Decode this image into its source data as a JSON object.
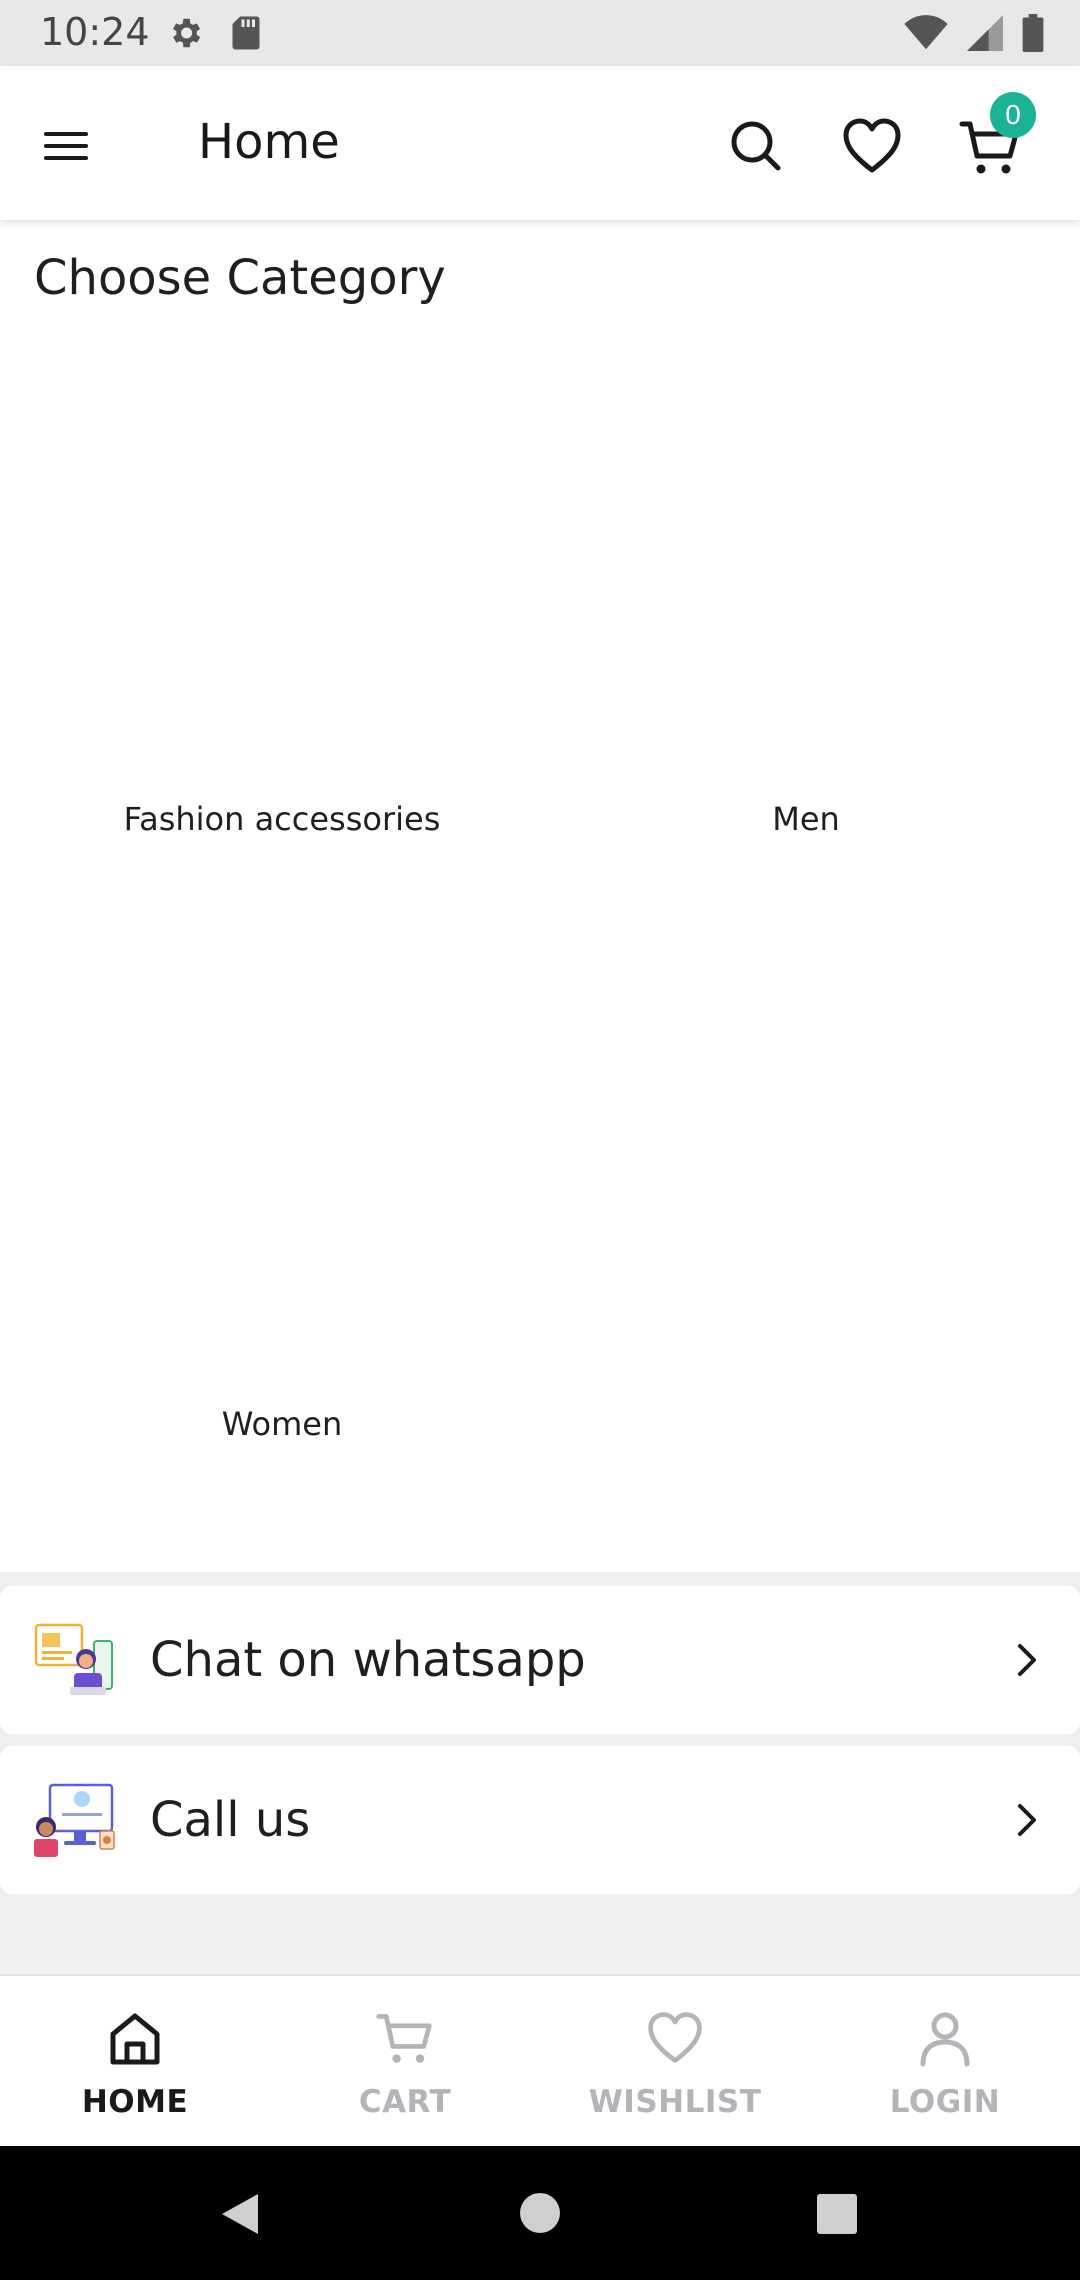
{
  "status_bar": {
    "time": "10:24"
  },
  "app_bar": {
    "title": "Home",
    "cart_count": "0"
  },
  "category_section": {
    "title": "Choose Category",
    "categories": [
      {
        "label": "Fashion accessories"
      },
      {
        "label": "Men"
      },
      {
        "label": "Women"
      }
    ]
  },
  "contact": {
    "whatsapp_label": "Chat on whatsapp",
    "call_label": "Call us"
  },
  "bottom_nav": {
    "items": [
      {
        "label": "HOME",
        "icon": "home-icon",
        "active": true
      },
      {
        "label": "CART",
        "icon": "cart-icon",
        "active": false
      },
      {
        "label": "WISHLIST",
        "icon": "heart-icon",
        "active": false
      },
      {
        "label": "LOGIN",
        "icon": "user-icon",
        "active": false
      }
    ]
  },
  "colors": {
    "accent": "#1ab394",
    "inactive_nav": "#b3b3b8",
    "page_background": "#f0f0f0"
  }
}
